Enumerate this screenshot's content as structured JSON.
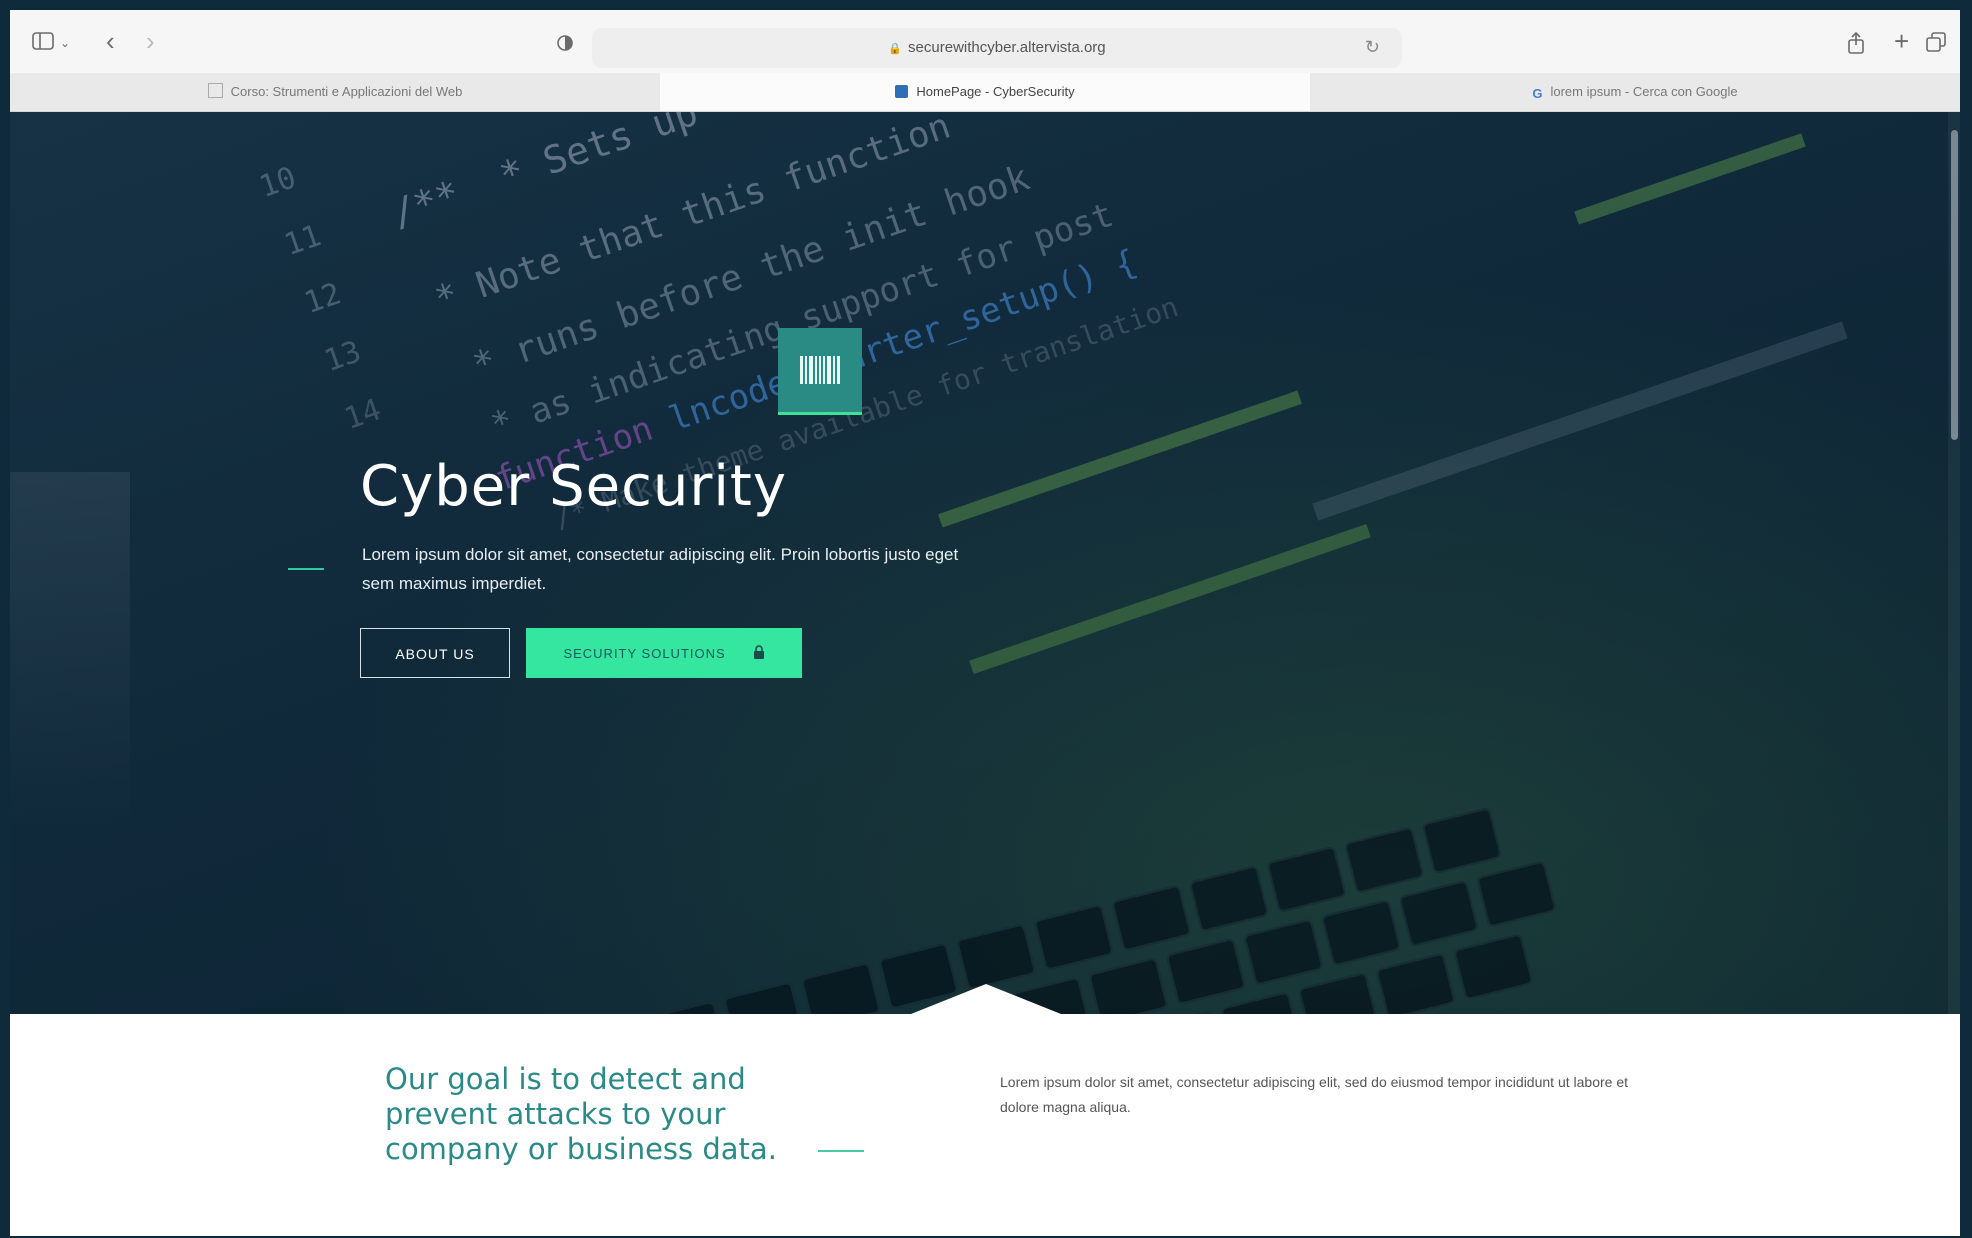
{
  "browser": {
    "url": "securewithcyber.altervista.org",
    "tabs": [
      {
        "label": "Corso: Strumenti e Applicazioni del Web",
        "active": false
      },
      {
        "label": "HomePage - CyberSecurity",
        "active": true
      },
      {
        "label": "lorem ipsum - Cerca con Google",
        "active": false
      }
    ],
    "icons": {
      "sidebar": "sidebar-icon",
      "back": "chevron-left-icon",
      "forward": "chevron-right-icon",
      "privacy": "shield-icon",
      "lock": "lock-icon",
      "reload": "reload-icon",
      "share": "share-icon",
      "new_tab": "plus-icon",
      "tab_overview": "tabs-icon"
    }
  },
  "hero": {
    "title": "Cyber Security",
    "lead": "Lorem ipsum dolor sit amet, consectetur adipiscing elit. Proin lobortis justo eget sem maximus imperdiet.",
    "about_button": "ABOUT US",
    "security_button": "SECURITY SOLUTIONS",
    "accent_color": "#35e6a0",
    "logo_color": "#2a8a84"
  },
  "intro": {
    "goal": "Our goal is to detect and prevent attacks to your company or business data.",
    "text": "Lorem ipsum dolor sit amet, consectetur adipiscing elit, sed do eiusmod tempor incididunt ut labore et dolore magna aliqua.",
    "heading_color": "#2a8a88"
  }
}
